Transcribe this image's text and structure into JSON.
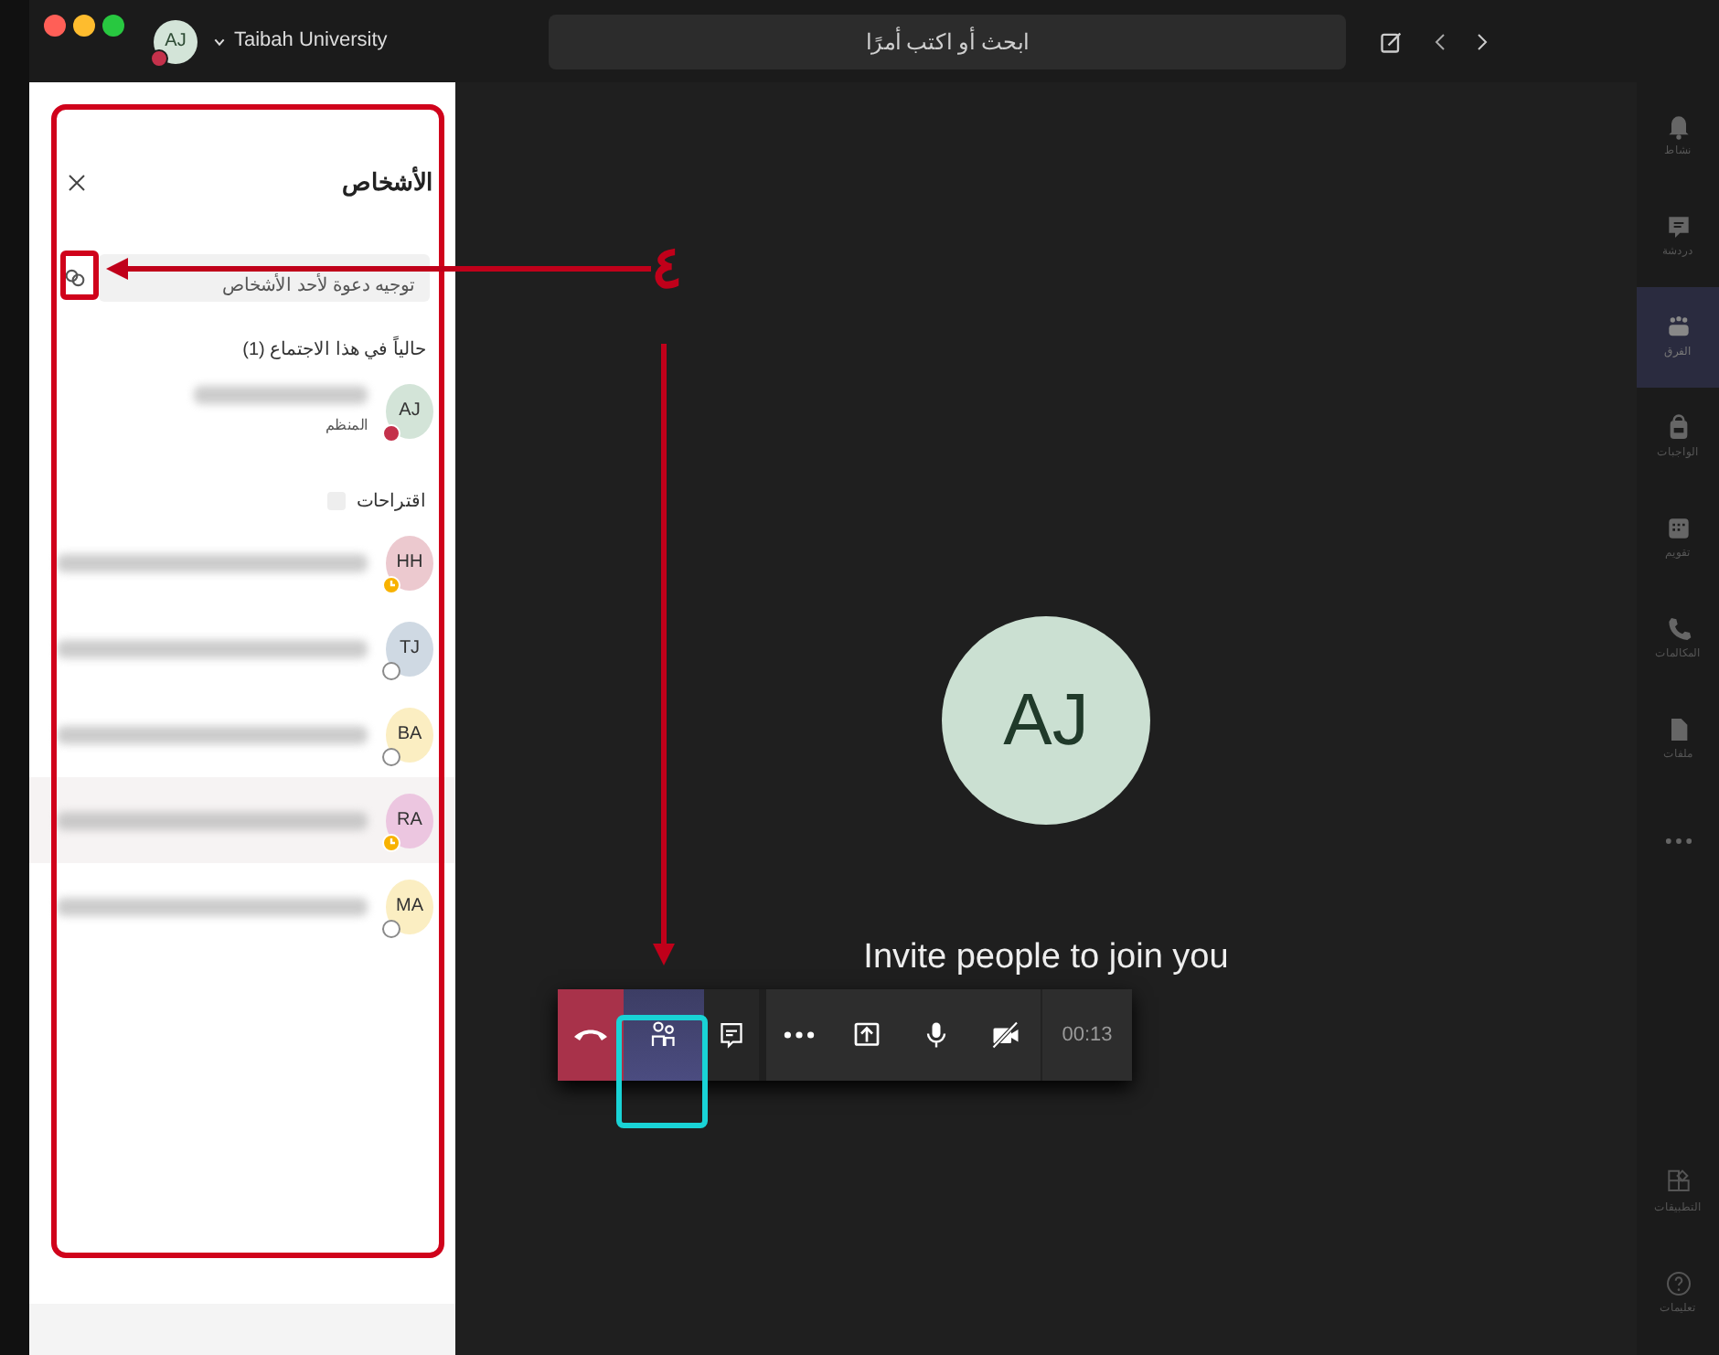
{
  "title_bar": {
    "avatar": "AJ",
    "organization": "Taibah University",
    "search": {
      "placeholder": "ابحث أو اكتب أمرًا"
    }
  },
  "people_panel": {
    "title": "الأشخاص",
    "invite": {
      "placeholder": "توجيه دعوة لأحد الأشخاص"
    },
    "in_meeting": {
      "heading": "حالياً في هذا الاجتماع (1)",
      "people": [
        {
          "initials": "AJ",
          "role": "المنظم",
          "color": "#d3e4d8",
          "presence": {
            "kind": "dot",
            "color": "#c4314b"
          }
        }
      ]
    },
    "suggestions": {
      "heading": "اقتراحات",
      "people": [
        {
          "initials": "HH",
          "color": "#ecc9cf",
          "presence": {
            "kind": "clock",
            "color": "#f8b200"
          },
          "highlighted": false
        },
        {
          "initials": "TJ",
          "color": "#cfd9e3",
          "presence": {
            "kind": "ring",
            "color": "#8a8a8a"
          },
          "highlighted": false
        },
        {
          "initials": "BA",
          "color": "#fbeec2",
          "presence": {
            "kind": "ring",
            "color": "#8a8a8a"
          },
          "highlighted": false
        },
        {
          "initials": "RA",
          "color": "#ecc6e0",
          "presence": {
            "kind": "clock",
            "color": "#f8b200"
          },
          "highlighted": true
        },
        {
          "initials": "MA",
          "color": "#fbeec2",
          "presence": {
            "kind": "ring",
            "color": "#8a8a8a"
          },
          "highlighted": false
        }
      ]
    }
  },
  "stage": {
    "avatar": "AJ",
    "caption": "Invite people to join you",
    "controls": [
      {
        "kind": "hangup",
        "selected": false
      },
      {
        "kind": "people",
        "selected": true
      },
      {
        "kind": "chat",
        "selected": false
      },
      {
        "kind": "more",
        "selected": false
      },
      {
        "kind": "share",
        "selected": false
      },
      {
        "kind": "mic",
        "selected": false
      },
      {
        "kind": "camera-off",
        "selected": false
      }
    ],
    "timer": "00:13"
  },
  "app_bar": {
    "items": [
      {
        "kind": "bell",
        "label": "نشاط",
        "selected": false
      },
      {
        "kind": "chat",
        "label": "دردشة",
        "selected": false
      },
      {
        "kind": "teams",
        "label": "الفرق",
        "selected": true
      },
      {
        "kind": "bag",
        "label": "الواجبات",
        "selected": false
      },
      {
        "kind": "calendar",
        "label": "تقويم",
        "selected": false
      },
      {
        "kind": "phone",
        "label": "المكالمات",
        "selected": false
      },
      {
        "kind": "file",
        "label": "ملفات",
        "selected": false
      },
      {
        "kind": "more",
        "selected": false
      }
    ],
    "bottom": [
      {
        "kind": "apps",
        "label": "التطبيقات",
        "selected": false
      },
      {
        "kind": "help",
        "label": "تعليمات",
        "selected": false
      }
    ]
  },
  "annotation": {
    "step": "٤"
  }
}
